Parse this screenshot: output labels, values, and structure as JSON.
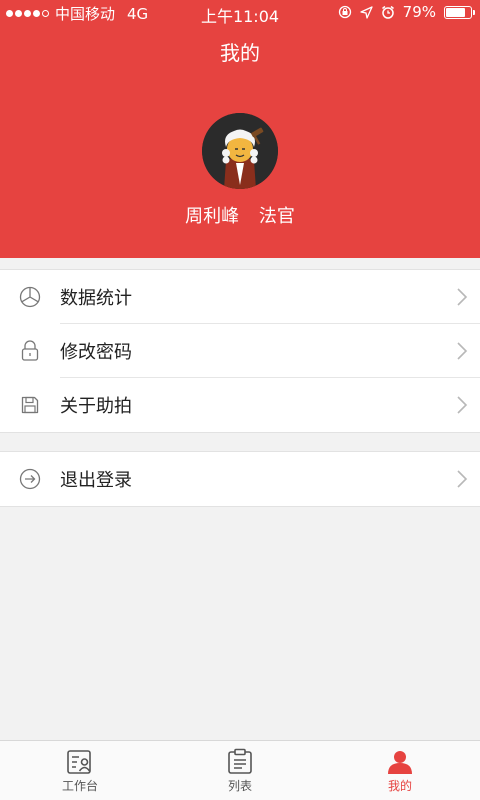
{
  "status_bar": {
    "carrier": "中国移动",
    "network": "4G",
    "time": "上午11:04",
    "battery_percent": "79%",
    "battery_level": 0.79
  },
  "header": {
    "title": "我的",
    "user_name": "周利峰",
    "user_role": "法官",
    "brand_color": "#e64340"
  },
  "menu": [
    {
      "label": "数据统计",
      "icon": "pie-chart-icon"
    },
    {
      "label": "修改密码",
      "icon": "lock-icon"
    },
    {
      "label": "关于助拍",
      "icon": "save-disk-icon"
    }
  ],
  "logout": {
    "label": "退出登录",
    "icon": "logout-icon"
  },
  "tabbar": [
    {
      "label": "工作台",
      "icon": "workbench-icon",
      "active": false
    },
    {
      "label": "列表",
      "icon": "clipboard-list-icon",
      "active": false
    },
    {
      "label": "我的",
      "icon": "user-icon",
      "active": true
    }
  ]
}
